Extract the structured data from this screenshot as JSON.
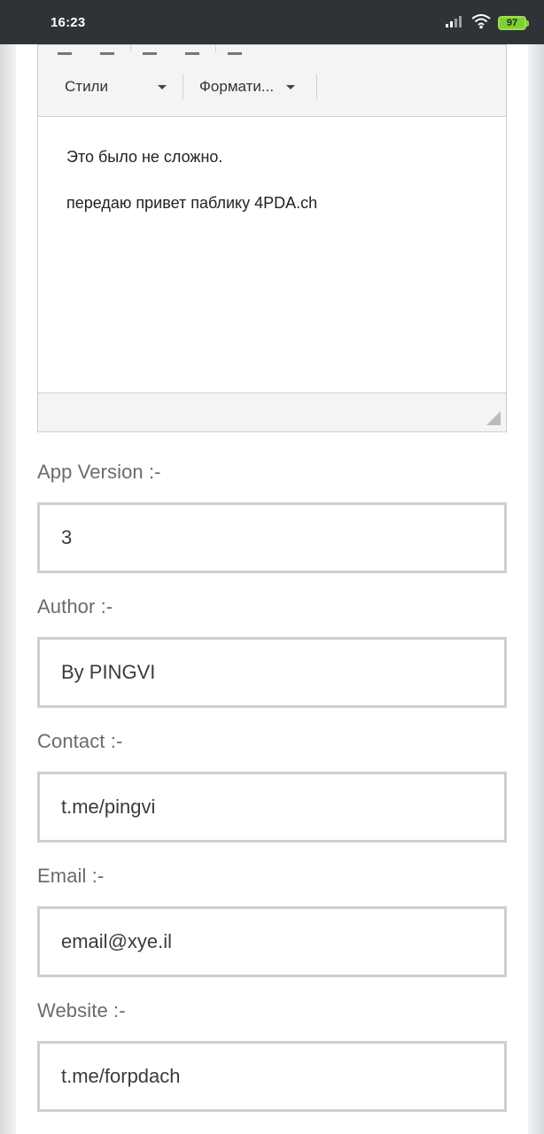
{
  "status_bar": {
    "time": "16:23",
    "battery": "97",
    "icons": [
      "signal-icon",
      "wifi-icon",
      "battery-icon"
    ]
  },
  "editor": {
    "toolbar": {
      "styles_label": "Стили",
      "format_label": "Формати..."
    },
    "content": {
      "paragraphs": [
        "Это было не сложно.",
        "передаю привет паблику 4PDA.ch"
      ]
    }
  },
  "form": {
    "app_version": {
      "label": "App Version :-",
      "value": "3"
    },
    "author": {
      "label": "Author :-",
      "value": "By PINGVI"
    },
    "contact": {
      "label": "Contact :-",
      "value": "t.me/pingvi"
    },
    "email": {
      "label": "Email :-",
      "value": "email@xye.il"
    },
    "website": {
      "label": "Website :-",
      "value": "t.me/forpdach"
    }
  },
  "colors": {
    "status_bar_bg": "#2f3337",
    "battery_green": "#7ed03a",
    "field_border": "#cfcfcf",
    "label_text": "#6b6b6b"
  }
}
